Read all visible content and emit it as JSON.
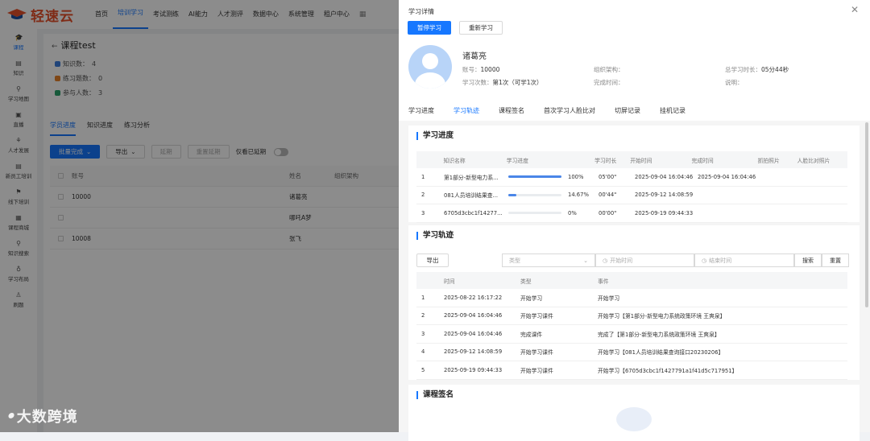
{
  "app": {
    "logo_text": "轻速云"
  },
  "topnav": {
    "items": [
      "首页",
      "培训学习",
      "考试测练",
      "AI能力",
      "人才测评",
      "数据中心",
      "系统管理",
      "租户中心"
    ],
    "active_index": 1
  },
  "sidebar": {
    "items": [
      "课程",
      "知识",
      "学习地图",
      "直播",
      "人才发展",
      "新员工培训",
      "线下培训",
      "课程商城",
      "知识搜索",
      "学习布局",
      "刷题"
    ],
    "active_index": 0
  },
  "main": {
    "back_title": "课程test",
    "stats": [
      {
        "label": "知识数：",
        "value": "4",
        "color": "#3b7ddd"
      },
      {
        "label": "练习题数：",
        "value": "0",
        "color": "#e8812a"
      },
      {
        "label": "参与人数：",
        "value": "3",
        "color": "#2aa36b"
      }
    ],
    "tabs": [
      "学员进度",
      "知识进度",
      "练习分析"
    ],
    "buttons": {
      "batch": "批量完成",
      "export": "导出",
      "extend": "延期",
      "reset_extend": "重置延期",
      "only_extended": "仅看已延期"
    },
    "table": {
      "headers": [
        "账号",
        "姓名",
        "组织架构"
      ],
      "rows": [
        {
          "account": "10000",
          "name": "诸葛亮"
        },
        {
          "account": "",
          "name": "哪吒A梦"
        },
        {
          "account": "10008",
          "name": "张飞"
        }
      ]
    }
  },
  "watermark": {
    "logo": "i(💬",
    "text": "大数跨境"
  },
  "drawer": {
    "title": "学习详情",
    "pause_button": "暂停学习",
    "restart_button": "重新学习",
    "user": {
      "name": "诸葛亮",
      "account_label": "账号：",
      "account": "10000",
      "times_label": "学习次数：",
      "times": "第1次（可学1次）",
      "org_label": "组织架构：",
      "org": "",
      "finish_label": "完成时间：",
      "finish": "",
      "total_label": "总学习时长：",
      "total": "05分44秒",
      "note_label": "说明：",
      "note": ""
    },
    "tabs": [
      "学习进度",
      "学习轨迹",
      "课程签名",
      "首次学习人脸比对",
      "切屏记录",
      "挂机记录"
    ],
    "active_tab": 1,
    "progress_section": {
      "title": "学习进度",
      "headers": [
        "",
        "知识名称",
        "学习进度",
        "学习时长",
        "开始时间",
        "完成时间",
        "抓拍照片",
        "人脸比对照片"
      ],
      "rows": [
        {
          "no": "1",
          "name": "第1部分-新型电力系...",
          "progress": 100,
          "progress_text": "100%",
          "duration": "05'00\"",
          "start": "2025-09-04 16:04:46",
          "end": "2025-09-04 16:04:46"
        },
        {
          "no": "2",
          "name": "081人员培训结果查...",
          "progress": 14.67,
          "progress_text": "14.67%",
          "duration": "00'44\"",
          "start": "2025-09-12 14:08:59",
          "end": ""
        },
        {
          "no": "3",
          "name": "6705d3cbc1f14277...",
          "progress": 0,
          "progress_text": "0%",
          "duration": "00'00\"",
          "start": "2025-09-19 09:44:33",
          "end": ""
        }
      ]
    },
    "track_section": {
      "title": "学习轨迹",
      "export": "导出",
      "type_placeholder": "类型",
      "start_placeholder": "开始时间",
      "end_placeholder": "结束时间",
      "search": "搜索",
      "reset": "重置",
      "headers": [
        "",
        "时间",
        "类型",
        "事件"
      ],
      "rows": [
        {
          "no": "1",
          "time": "2025-08-22 16:17:22",
          "type": "开始学习",
          "event": "开始学习"
        },
        {
          "no": "2",
          "time": "2025-09-04 16:04:46",
          "type": "开始学习课件",
          "event": "开始学习【第1部分-新型电力系统政策环境 王爽泉】"
        },
        {
          "no": "3",
          "time": "2025-09-04 16:04:46",
          "type": "完成课件",
          "event": "完成了【第1部分-新型电力系统政策环境 王爽泉】"
        },
        {
          "no": "4",
          "time": "2025-09-12 14:08:59",
          "type": "开始学习课件",
          "event": "开始学习【081人员培训结果查询接口20230206】"
        },
        {
          "no": "5",
          "time": "2025-09-19 09:44:33",
          "type": "开始学习课件",
          "event": "开始学习【6705d3cbc1f1427791a1f41d5c717951】"
        }
      ]
    },
    "sign_section": {
      "title": "课程签名"
    }
  },
  "colors": {
    "accent": "#1677ff",
    "logo": "#e8502a",
    "progress": "#4a86e8"
  }
}
